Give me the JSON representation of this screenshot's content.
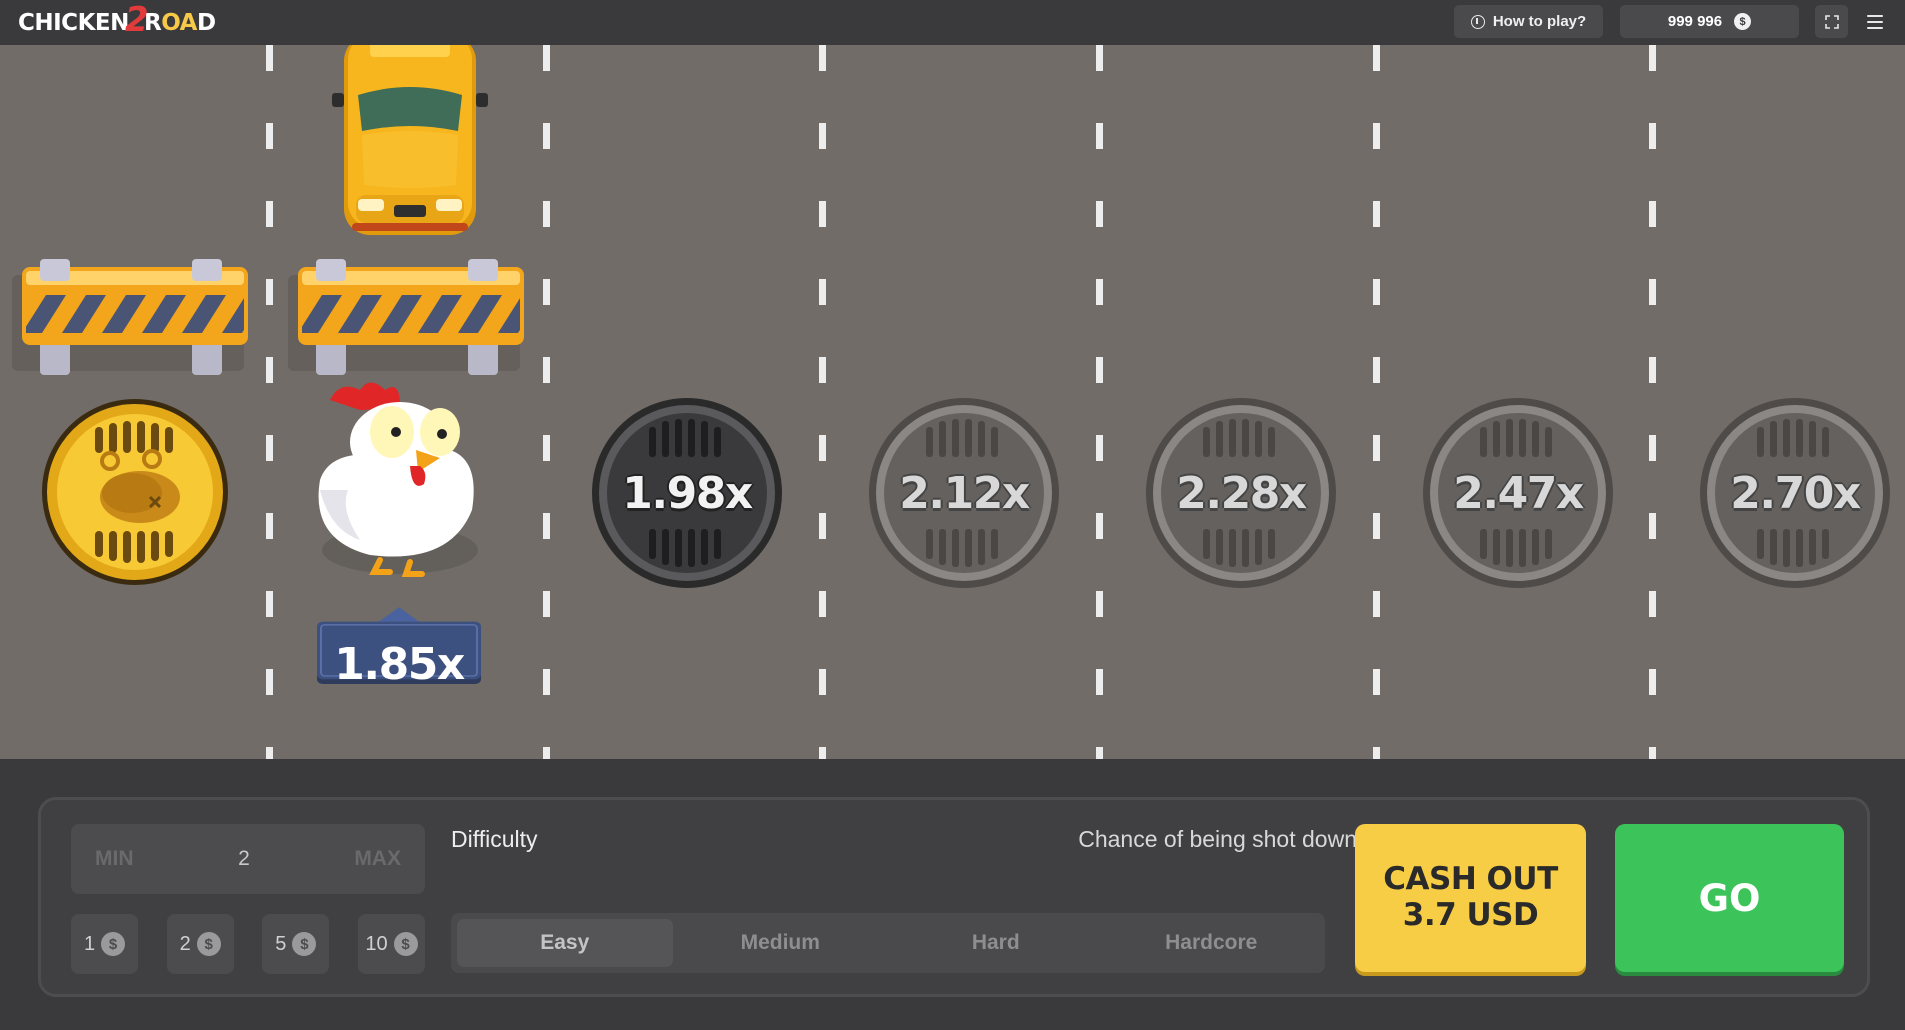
{
  "header": {
    "logo_part1": "CHICKEN",
    "logo_part2": "2",
    "logo_part3": "R",
    "logo_part4": "OA",
    "logo_part5": "D",
    "how_to_play": "How to play?",
    "balance": "999 996",
    "currency_symbol": "$"
  },
  "game": {
    "current_multiplier": "1.85x",
    "lanes": [
      {
        "multiplier": "1.98x",
        "state": "next"
      },
      {
        "multiplier": "2.12x",
        "state": "upcoming"
      },
      {
        "multiplier": "2.28x",
        "state": "upcoming"
      },
      {
        "multiplier": "2.47x",
        "state": "upcoming"
      },
      {
        "multiplier": "2.70x",
        "state": "upcoming"
      }
    ]
  },
  "controls": {
    "bet": {
      "min_label": "MIN",
      "value": "2",
      "max_label": "MAX"
    },
    "chips": [
      {
        "amount": "1",
        "symbol": "$"
      },
      {
        "amount": "2",
        "symbol": "$"
      },
      {
        "amount": "5",
        "symbol": "$"
      },
      {
        "amount": "10",
        "symbol": "$"
      }
    ],
    "difficulty_label": "Difficulty",
    "chance_label": "Chance of being shot down",
    "difficulties": [
      {
        "label": "Easy",
        "active": true
      },
      {
        "label": "Medium",
        "active": false
      },
      {
        "label": "Hard",
        "active": false
      },
      {
        "label": "Hardcore",
        "active": false
      }
    ],
    "cashout_line1": "CASH OUT",
    "cashout_line2": "3.7 USD",
    "go_label": "GO"
  },
  "colors": {
    "road": "#716c67",
    "cashout": "#f8cd46",
    "go": "#3cc35a",
    "multiplier_tag": "#3d5180"
  }
}
